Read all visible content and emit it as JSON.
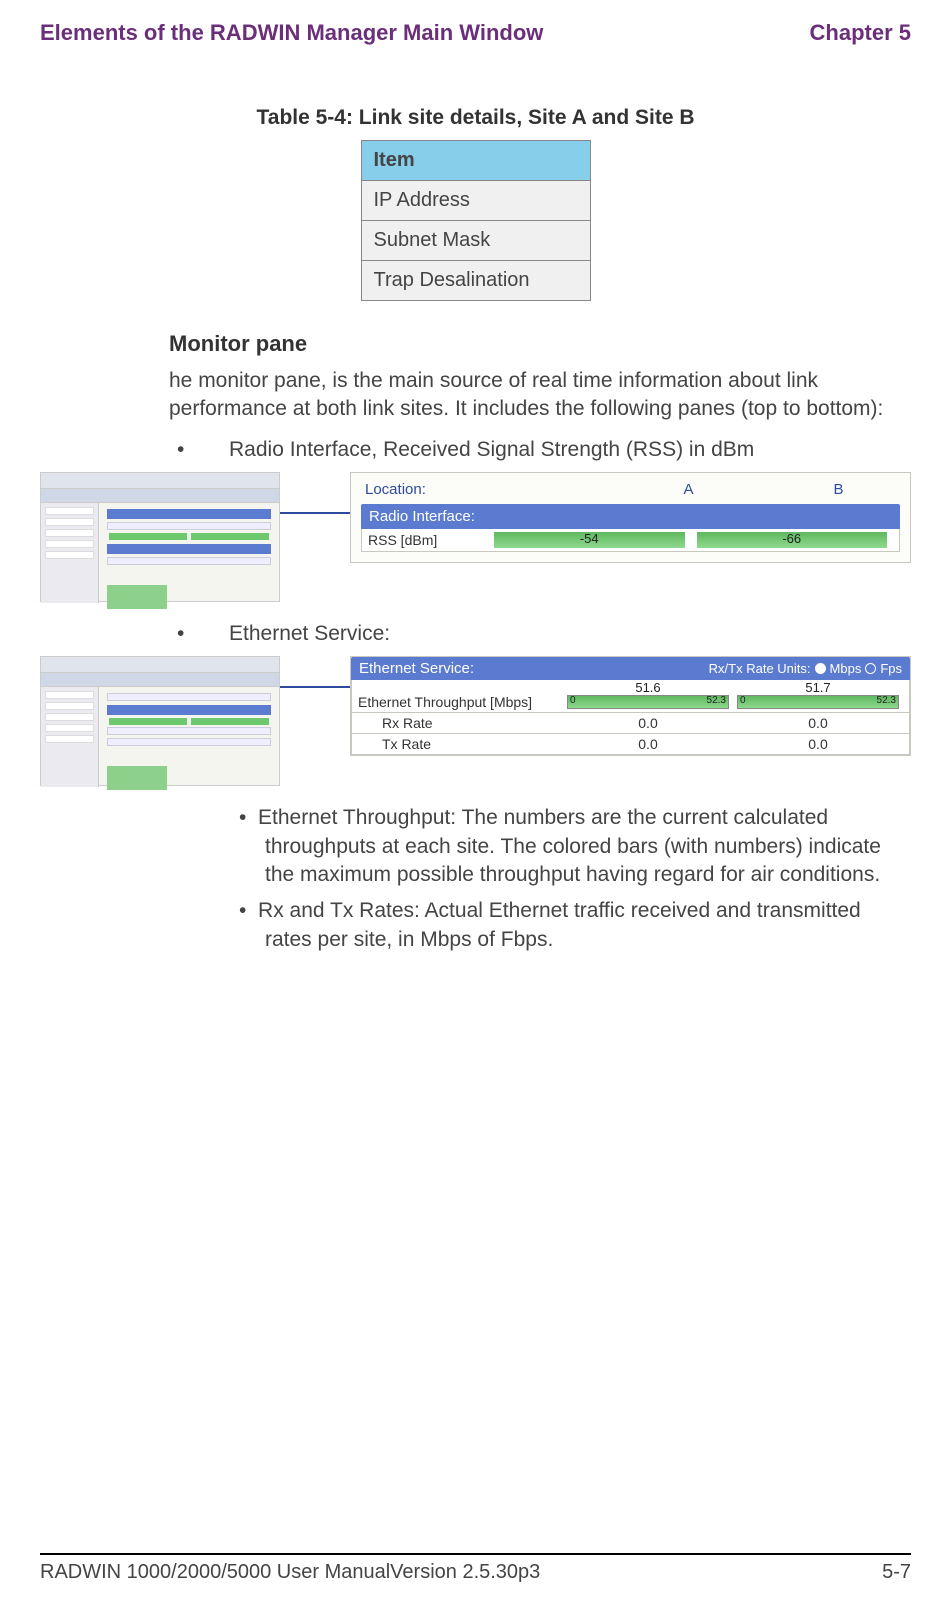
{
  "header": {
    "section": "Elements of the RADWIN Manager Main Window",
    "chapter": "Chapter 5"
  },
  "table": {
    "caption": "Table 5-4: Link site details, Site A and Site B",
    "header": "Item",
    "rows": [
      "IP Address",
      "Subnet Mask",
      "Trap Desalination"
    ]
  },
  "monitor": {
    "heading": "Monitor pane",
    "intro": "he monitor pane, is the main source of real time information about link performance at both link sites. It includes the following panes (top to bottom):",
    "bullet_radio": "Radio Interface, Received Signal Strength (RSS) in dBm",
    "bullet_eth": "Ethernet Service:",
    "sub_ethtp": "Ethernet Throughput: The numbers are the current calculated throughputs at each site. The colored bars (with numbers) indicate the maximum possible throughput having regard for air conditions.",
    "sub_rxtx": "Rx and Tx Rates: Actual Ethernet traffic received and transmitted rates per site, in Mbps of Fbps."
  },
  "radio_panel": {
    "location_label": "Location:",
    "col_a": "A",
    "col_b": "B",
    "section": "Radio Interface:",
    "row_label": "RSS [dBm]",
    "val_a": "-54",
    "val_b": "-66"
  },
  "eth_panel": {
    "section": "Ethernet Service:",
    "units_label": "Rx/Tx Rate Units:",
    "unit_mbps": "Mbps",
    "unit_fps": "Fps",
    "tp_label": "Ethernet Throughput [Mbps]",
    "tp_a": "51.6",
    "tp_b": "51.7",
    "tp_a_min": "0",
    "tp_a_max": "52.3",
    "tp_b_min": "0",
    "tp_b_max": "52.3",
    "rx_label": "Rx Rate",
    "tx_label": "Tx Rate",
    "rx_a": "0.0",
    "rx_b": "0.0",
    "tx_a": "0.0",
    "tx_b": "0.0"
  },
  "footer": {
    "left": "RADWIN 1000/2000/5000 User ManualVersion  2.5.30p3",
    "right": "5-7"
  },
  "chart_data": [
    {
      "type": "bar",
      "title": "Radio Interface RSS",
      "categories": [
        "A",
        "B"
      ],
      "values": [
        -54,
        -66
      ],
      "ylabel": "RSS [dBm]"
    },
    {
      "type": "bar",
      "title": "Ethernet Throughput [Mbps]",
      "categories": [
        "A",
        "B"
      ],
      "values": [
        51.6,
        51.7
      ],
      "ylim": [
        0,
        52.3
      ],
      "ylabel": "Mbps"
    },
    {
      "type": "table",
      "title": "Rx/Tx Rate (Mbps)",
      "rows": [
        {
          "label": "Rx Rate",
          "A": 0.0,
          "B": 0.0
        },
        {
          "label": "Tx Rate",
          "A": 0.0,
          "B": 0.0
        }
      ]
    }
  ]
}
